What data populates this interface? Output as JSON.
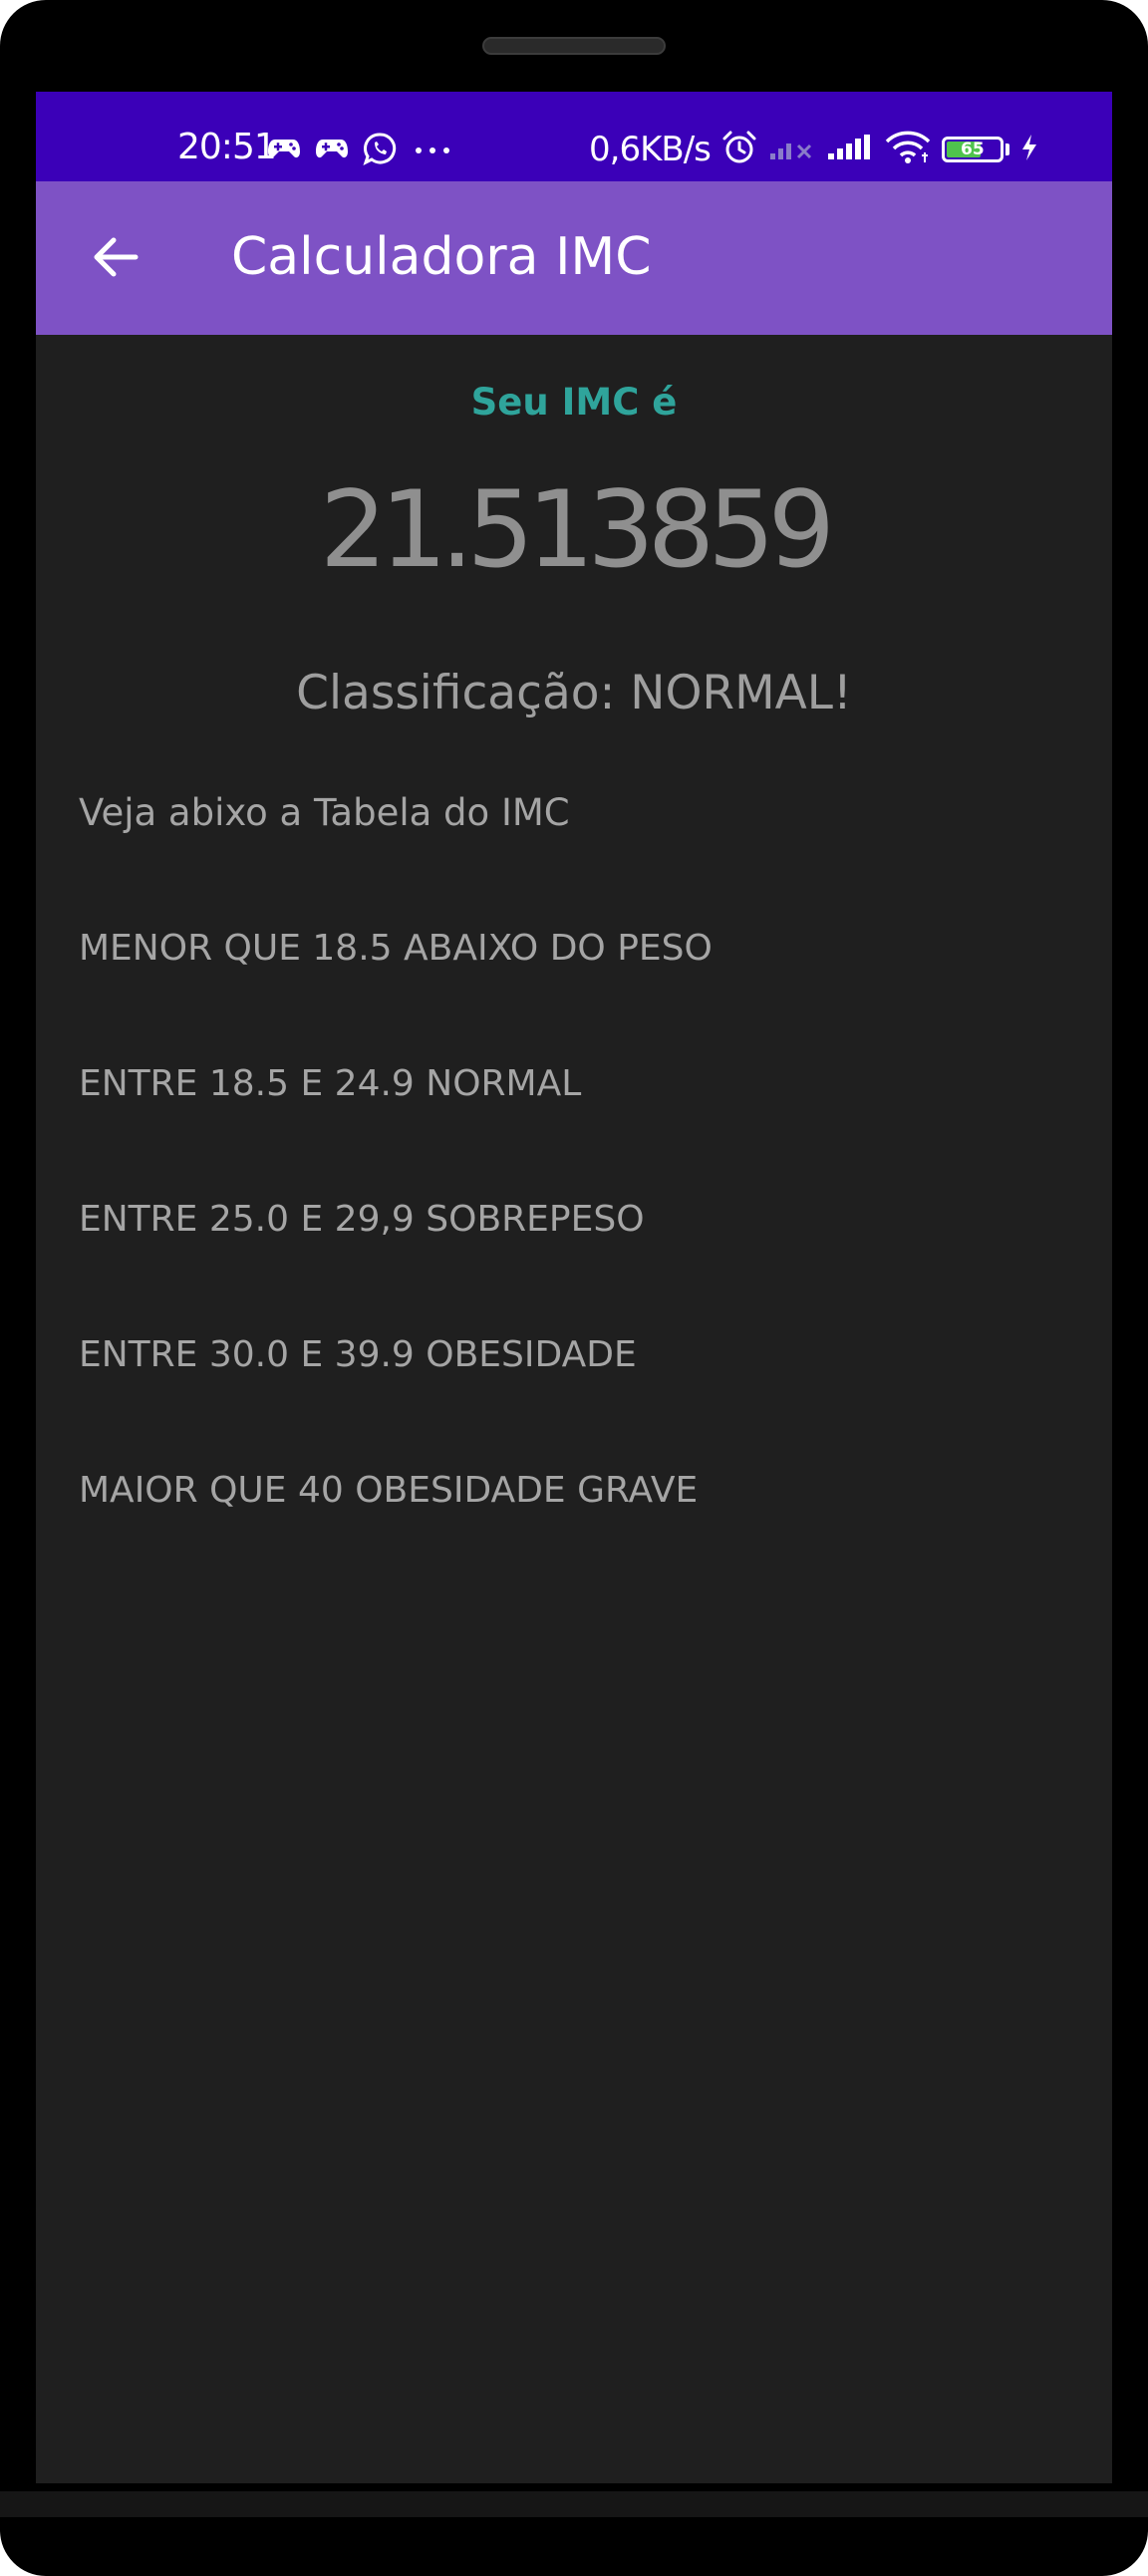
{
  "status_bar": {
    "time": "20:51",
    "network_speed": "0,6KB/s",
    "battery_level": "65",
    "battery_fraction": 0.65,
    "left_icons": [
      "game-controller-icon",
      "game-controller-icon",
      "whatsapp-icon",
      "more-dots-icon"
    ],
    "right_icons": [
      "alarm-icon",
      "no-signal-icon",
      "signal-icon",
      "wifi-icon",
      "battery-icon",
      "charging-icon"
    ]
  },
  "app_bar": {
    "back_icon": "arrow-back-icon",
    "title": "Calculadora IMC"
  },
  "result": {
    "label": "Seu IMC é",
    "value": "21.513859",
    "classification": "Classificação: NORMAL!"
  },
  "table": {
    "intro": "Veja abixo a Tabela do IMC",
    "rows": [
      "MENOR QUE 18.5 ABAIXO DO PESO",
      "ENTRE 18.5 E 24.9 NORMAL",
      "ENTRE 25.0 E 29,9 SOBREPESO",
      "ENTRE 30.0 E 39.9 OBESIDADE",
      "MAIOR QUE 40 OBESIDADE GRAVE"
    ]
  },
  "colors": {
    "status_bar": "#3b00b8",
    "app_bar": "#7e52c5",
    "background": "#1f1f1f",
    "accent_teal": "#2fa49b",
    "text_gray": "#a5a5a5"
  }
}
